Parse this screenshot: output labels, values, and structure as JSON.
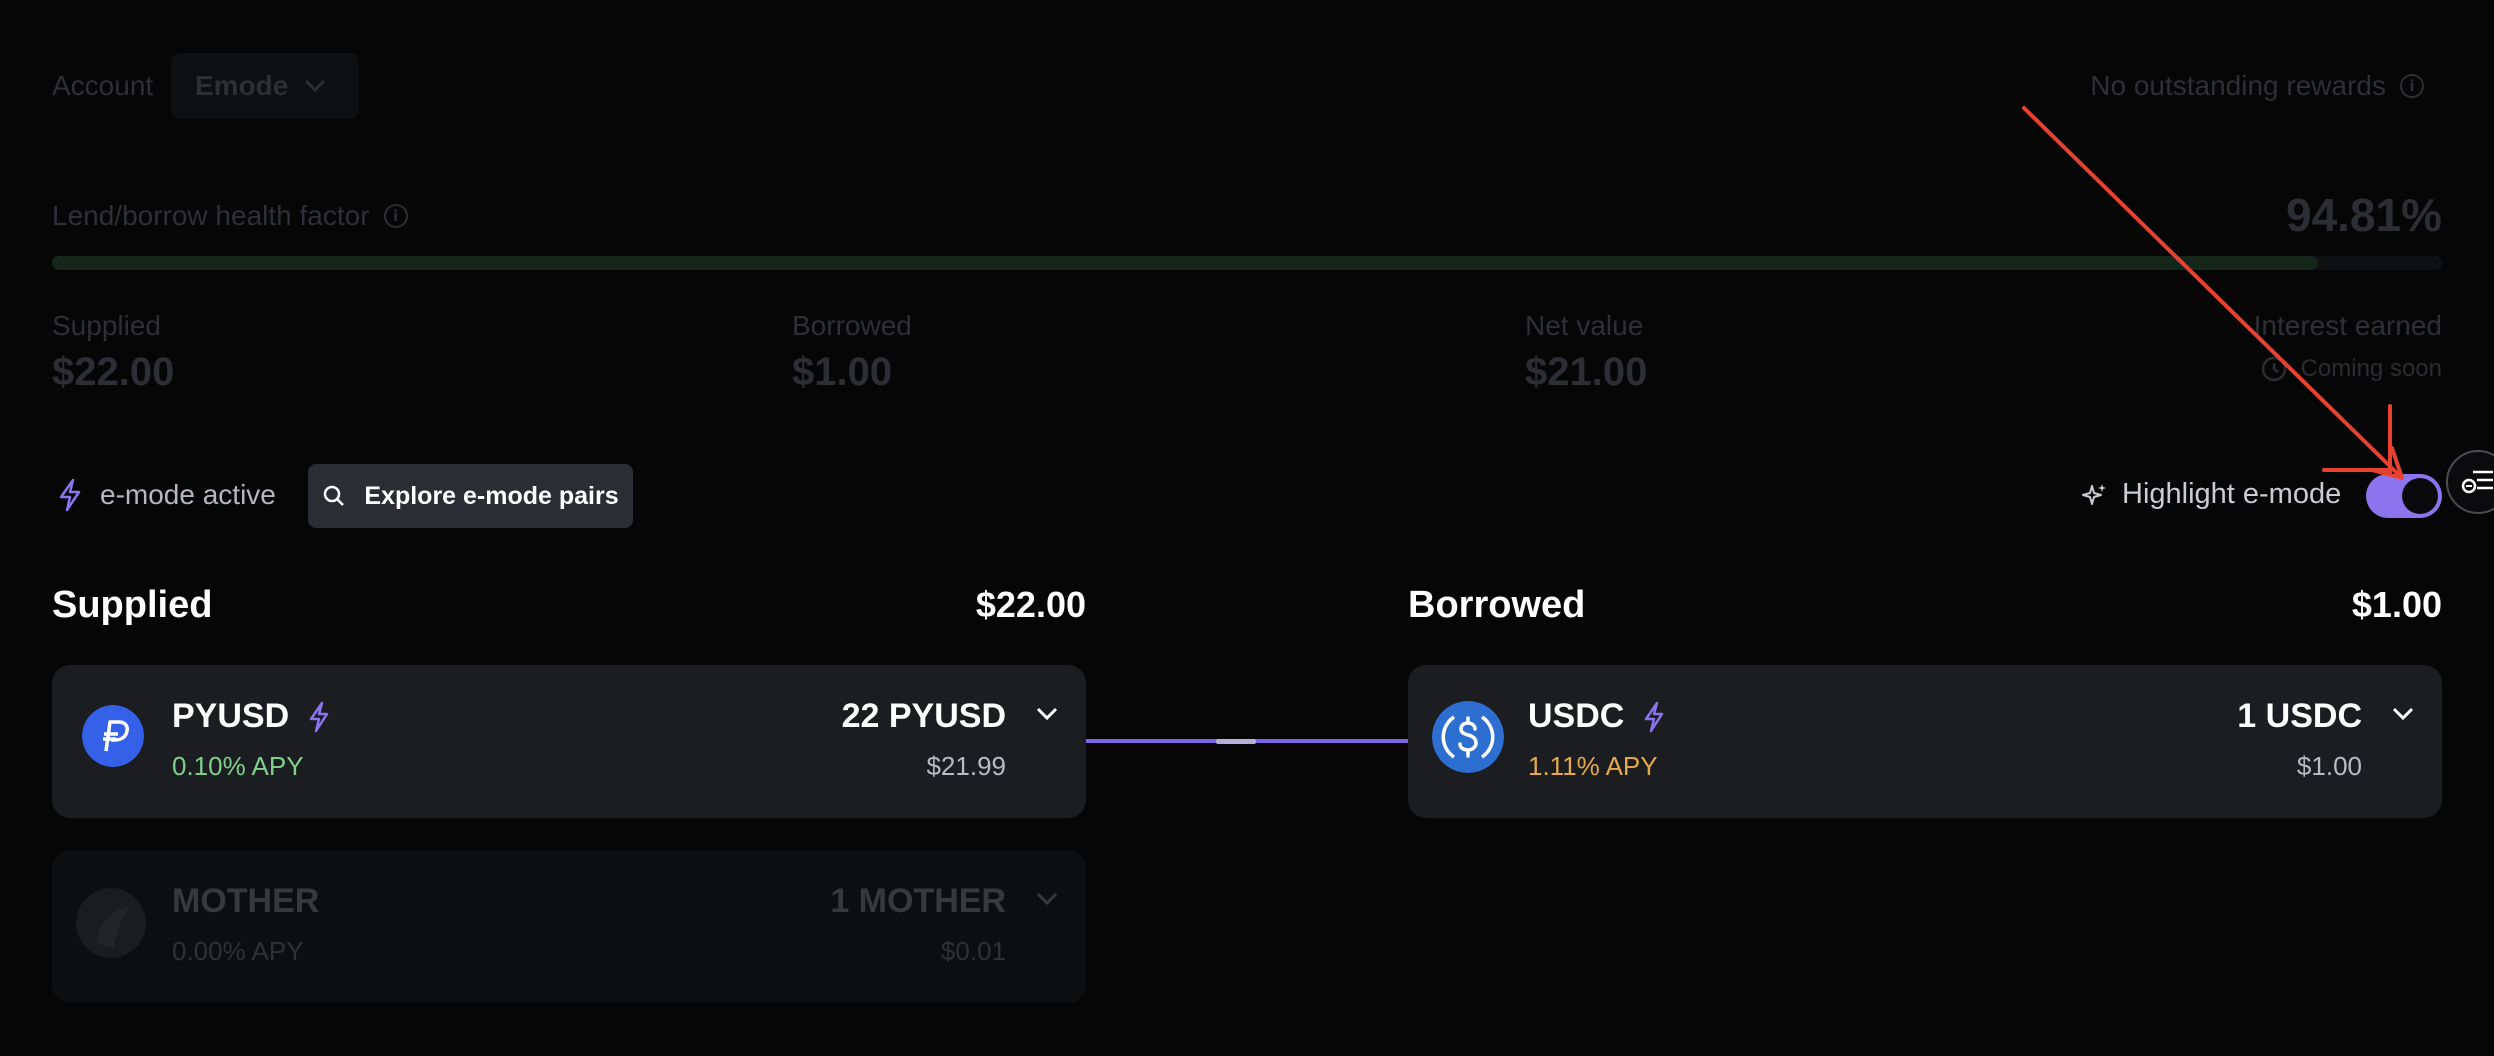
{
  "header": {
    "account_label": "Account",
    "account_value": "Emode",
    "rewards_text": "No outstanding rewards"
  },
  "health": {
    "label": "Lend/borrow health factor",
    "value": "94.81%",
    "fill_percent": 94.81
  },
  "stats": {
    "supplied_label": "Supplied",
    "supplied_value": "$22.00",
    "borrowed_label": "Borrowed",
    "borrowed_value": "$1.00",
    "net_label": "Net value",
    "net_value": "$21.00",
    "interest_label": "Interest earned",
    "interest_value": "Coming soon"
  },
  "controls": {
    "emode_active": "e-mode active",
    "explore_button": "Explore e-mode pairs",
    "highlight_label": "Highlight e-mode",
    "toggle_on": true
  },
  "supplied": {
    "title": "Supplied",
    "total": "$22.00",
    "items": [
      {
        "symbol": "PYUSD",
        "apy": "0.10% APY",
        "amount": "22 PYUSD",
        "usd": "$21.99"
      },
      {
        "symbol": "MOTHER",
        "apy": "0.00% APY",
        "amount": "1 MOTHER",
        "usd": "$0.01"
      }
    ]
  },
  "borrowed": {
    "title": "Borrowed",
    "total": "$1.00",
    "items": [
      {
        "symbol": "USDC",
        "apy": "1.11% APY",
        "amount": "1 USDC",
        "usd": "$1.00"
      }
    ]
  },
  "colors": {
    "accent_purple": "#8b74ee",
    "apy_green": "#7ed08b",
    "apy_orange": "#e5a84a",
    "annotation_red": "#e8412f"
  },
  "icons": {
    "pyusd": "paypal-coin-icon",
    "usdc": "usdc-coin-icon",
    "mother": "mother-token-icon"
  }
}
